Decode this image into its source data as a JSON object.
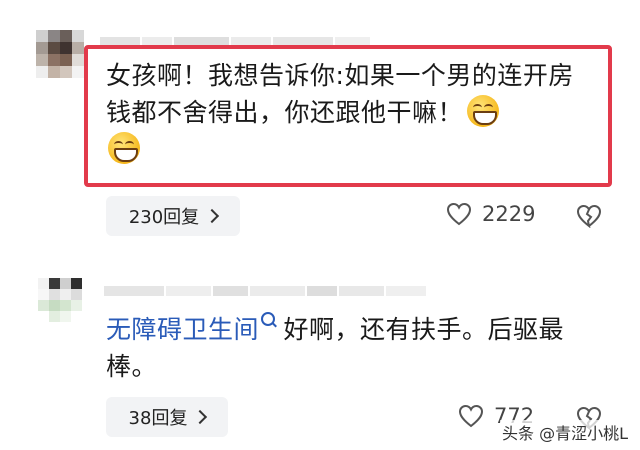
{
  "comments": [
    {
      "text": "女孩啊！我想告诉你:如果一个男的连开房钱都不舍得出，你还跟他干嘛！",
      "emoji_icon": "grinning-face-icon",
      "replies_label": "230回复",
      "like_count": "2229"
    },
    {
      "link_text": "无障碍卫生间",
      "text": "好啊，还有扶手。后驱最棒。",
      "replies_label": "38回复",
      "like_count": "772"
    }
  ],
  "watermark": "头条 @青涩小桃L",
  "colors": {
    "highlight_border": "#e23a4b",
    "link": "#2a5bb8",
    "pill_bg": "#f2f3f5"
  }
}
